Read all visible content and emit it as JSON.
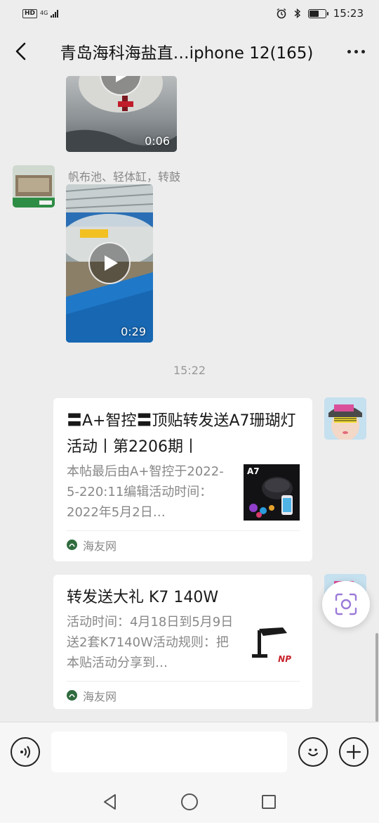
{
  "status_bar": {
    "hd": "HD",
    "network": "4G",
    "time": "15:23"
  },
  "header": {
    "title": "青岛海科海盐直…iphone 12(165)"
  },
  "messages": {
    "video1": {
      "duration": "0:06"
    },
    "sender_name": "帆布池、轻体缸，转鼓",
    "video2": {
      "duration": "0:29"
    },
    "timestamp": "15:22",
    "card1": {
      "title": "〓A+智控〓顶贴转发送A7珊瑚灯活动丨第2206期丨",
      "description": "本帖最后由A+智控于2022-5-220:11编辑活动时间：2022年5月2日…",
      "thumb_label": "A7",
      "source": "海友网"
    },
    "card2": {
      "title": "转发送大礼 K7 140W",
      "description": "活动时间：4月18日到5月9日送2套K7140W活动规则：把本贴活动分享到…",
      "thumb_label": "NP",
      "source": "海友网"
    }
  },
  "input": {
    "placeholder": ""
  },
  "icons": {
    "back": "chevron-left-icon",
    "more": "more-dots-icon",
    "voice": "voice-icon",
    "emoji": "emoji-icon",
    "add": "plus-icon",
    "scan": "scan-icon"
  }
}
